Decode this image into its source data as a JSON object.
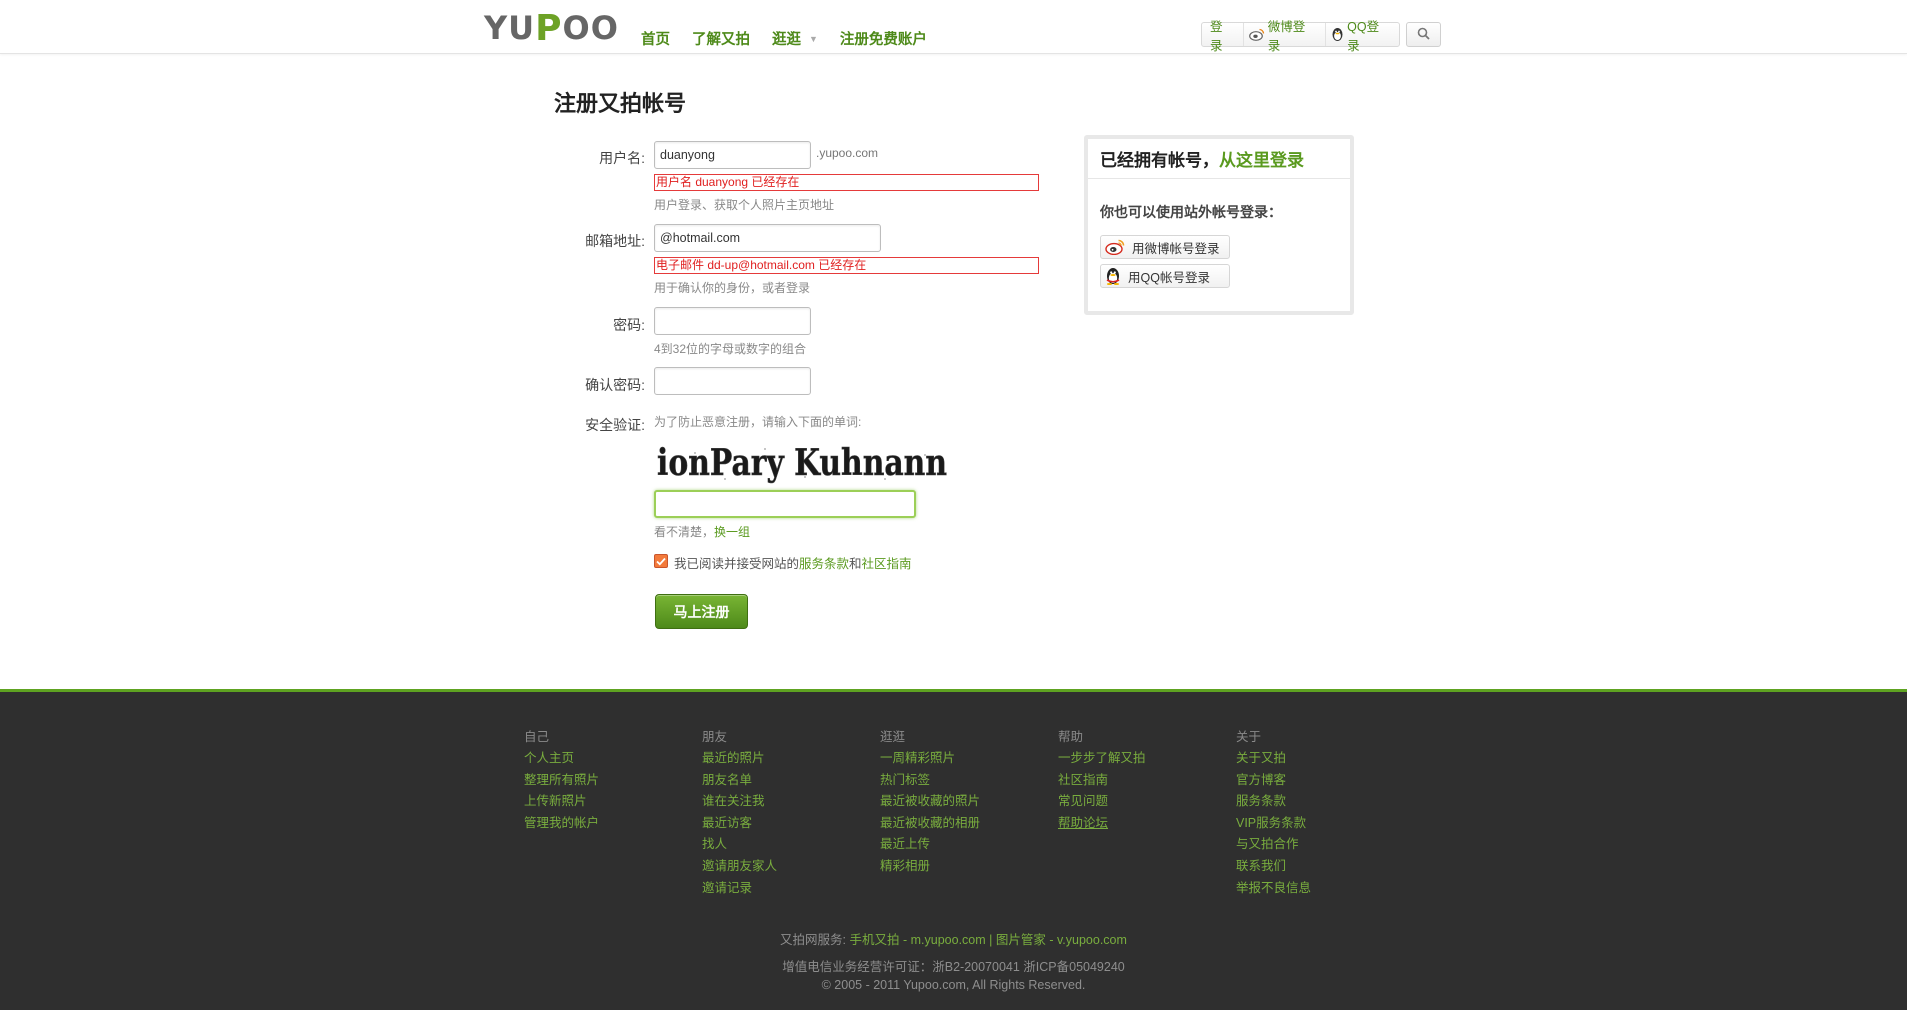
{
  "header": {
    "logo_text_1": "YU",
    "logo_text_p": "P",
    "logo_text_2": "OO",
    "nav": [
      "首页",
      "了解又拍",
      "逛逛",
      "注册免费账户"
    ],
    "login": "登录",
    "weibo_login": "微博登录",
    "qq_login": "QQ登录"
  },
  "page": {
    "title": "注册又拍帐号"
  },
  "form": {
    "username": {
      "label": "用户名:",
      "value": "duanyong",
      "suffix": ".yupoo.com",
      "error": "用户名 duanyong 已经存在",
      "hint": "用户登录、获取个人照片主页地址"
    },
    "email": {
      "label": "邮箱地址:",
      "value": "@hotmail.com",
      "error": "电子邮件 dd-up@hotmail.com 已经存在",
      "hint": "用于确认你的身份，或者登录"
    },
    "password": {
      "label": "密码:",
      "hint": "4到32位的字母或数字的组合"
    },
    "confirm": {
      "label": "确认密码:"
    },
    "captcha": {
      "label": "安全验证:",
      "instruction": "为了防止恶意注册，请输入下面的单词:",
      "image_text": "ionPary Kuhnann",
      "unclear": "看不清楚，",
      "refresh": "换一组"
    },
    "agree": {
      "prefix": "我已阅读并接受网站的",
      "terms": "服务条款",
      "and": "和",
      "guide": "社区指南",
      "checked": true
    },
    "submit": "马上注册"
  },
  "sidebar": {
    "title_prefix": "已经拥有帐号，",
    "title_link": "从这里登录",
    "subtitle": "你也可以使用站外帐号登录：",
    "weibo_button": "用微博帐号登录",
    "qq_button": "用QQ帐号登录"
  },
  "footer": {
    "columns": [
      {
        "title": "自己",
        "links": [
          "个人主页",
          "整理所有照片",
          "上传新照片",
          "管理我的帐户"
        ]
      },
      {
        "title": "朋友",
        "links": [
          "最近的照片",
          "朋友名单",
          "谁在关注我",
          "最近访客",
          "找人",
          "邀请朋友家人",
          "邀请记录"
        ]
      },
      {
        "title": "逛逛",
        "links": [
          "一周精彩照片",
          "热门标签",
          "最近被收藏的照片",
          "最近被收藏的相册",
          "最近上传",
          "精彩相册"
        ]
      },
      {
        "title": "帮助",
        "links": [
          "一步步了解又拍",
          "社区指南",
          "常见问题",
          "帮助论坛"
        ]
      },
      {
        "title": "关于",
        "links": [
          "关于又拍",
          "官方博客",
          "服务条款",
          "VIP服务条款",
          "与又拍合作",
          "联系我们",
          "举报不良信息"
        ]
      }
    ],
    "services_label": "又拍网服务:",
    "service_mobile": "手机又拍 - m.yupoo.com",
    "service_sep": "|",
    "service_v": "图片管家 - v.yupoo.com",
    "license": "增值电信业务经营许可证：浙B2-20070041 浙ICP备05049240",
    "copyright": "© 2005 - 2011 Yupoo.com, All Rights Reserved."
  },
  "colors": {
    "brand_green": "#5a9a1f",
    "error_red": "#e02020",
    "footer_bg": "#2f2f2f"
  }
}
